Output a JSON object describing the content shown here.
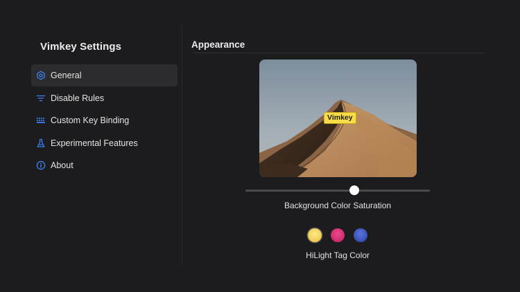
{
  "app": {
    "title": "Vimkey Settings"
  },
  "sidebar": {
    "items": [
      {
        "label": "General",
        "icon": "gear-icon",
        "active": true
      },
      {
        "label": "Disable Rules",
        "icon": "filter-icon",
        "active": false
      },
      {
        "label": "Custom Key Binding",
        "icon": "keyboard-icon",
        "active": false
      },
      {
        "label": "Experimental Features",
        "icon": "flask-icon",
        "active": false
      },
      {
        "label": "About",
        "icon": "info-icon",
        "active": false
      }
    ]
  },
  "main": {
    "section_title": "Appearance",
    "preview": {
      "hint_label": "Vimkey",
      "image": "desert-dune-wallpaper"
    },
    "saturation": {
      "label": "Background Color Saturation",
      "value": 0.59
    },
    "hilight": {
      "label": "HiLight Tag Color",
      "options": [
        "yellow",
        "pink",
        "blue"
      ],
      "selected": "yellow"
    }
  },
  "colors": {
    "accent": "#3b82f6",
    "background": "#1c1c1e",
    "active_item": "#2c2c2e",
    "swatch_yellow": "#f5d35a",
    "swatch_pink": "#d9307a",
    "swatch_blue": "#3d58c4",
    "hint_tag": "#f8dc4a"
  }
}
